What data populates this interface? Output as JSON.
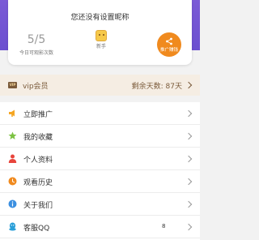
{
  "profile": {
    "nickname": "您还没有设置昵称",
    "views_count": "5/5",
    "views_label": "今日可观影次数",
    "level_label": "新手",
    "promo_label": "推广赚钱"
  },
  "vip": {
    "badge": "VIP",
    "label": "vip会员",
    "remaining": "剩余天数: 87天"
  },
  "menu": {
    "items": [
      {
        "label": "立即推广",
        "icon": "megaphone-icon",
        "color": "#f5a623"
      },
      {
        "label": "我的收藏",
        "icon": "star-icon",
        "color": "#7cc242"
      },
      {
        "label": "个人资料",
        "icon": "person-icon",
        "color": "#e8453c"
      },
      {
        "label": "观看历史",
        "icon": "clock-icon",
        "color": "#f08a1e"
      },
      {
        "label": "关于我们",
        "icon": "info-icon",
        "color": "#3b8fe0"
      },
      {
        "label": "客服QQ",
        "icon": "qq-icon",
        "color": "#2a9fd8",
        "value": "8"
      }
    ]
  },
  "colors": {
    "header_purple": "#6b4fd0",
    "vip_brown": "#7a5a3a",
    "vip_bg": "#f5ede3",
    "promo_orange": "#f08a1e"
  }
}
